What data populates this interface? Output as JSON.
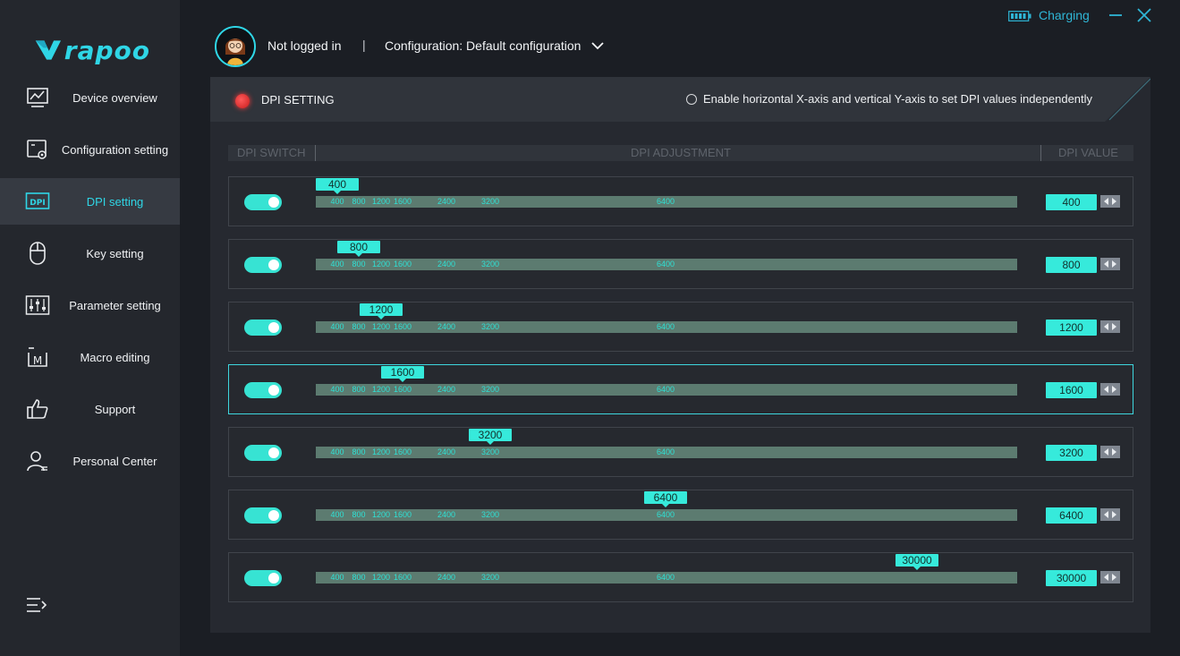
{
  "brand": {
    "name": "rapoo",
    "accent": "#2fd6e6"
  },
  "sidebar": {
    "items": [
      {
        "label": "Device overview",
        "icon": "chart-monitor-icon"
      },
      {
        "label": "Configuration setting",
        "icon": "config-gear-icon"
      },
      {
        "label": "DPI setting",
        "icon": "dpi-icon",
        "icon_text": "DPI",
        "active": true
      },
      {
        "label": "Key setting",
        "icon": "mouse-icon"
      },
      {
        "label": "Parameter setting",
        "icon": "sliders-icon"
      },
      {
        "label": "Macro editing",
        "icon": "macro-icon",
        "icon_text": "M"
      },
      {
        "label": "Support",
        "icon": "thumbs-up-icon"
      },
      {
        "label": "Personal Center",
        "icon": "user-icon"
      }
    ],
    "toggle_icon": "menu-expand-icon"
  },
  "topbar": {
    "user_status": "Not logged in",
    "separator": "|",
    "configuration": "Configuration: Default configuration",
    "charging": "Charging"
  },
  "panel": {
    "title": "DPI SETTING",
    "xy_option": "Enable horizontal X-axis and vertical Y-axis to set DPI values independently",
    "xy_enabled": false,
    "headers": {
      "switch": "DPI SWITCH",
      "adjust": "DPI ADJUSTMENT",
      "value": "DPI VALUE"
    }
  },
  "dpi": {
    "min": 400,
    "max": 30000,
    "tick_labels": [
      "400",
      "800",
      "1200",
      "1600",
      "2400",
      "3200",
      "6400"
    ],
    "levels": [
      {
        "value": 400,
        "label": "400",
        "enabled": true
      },
      {
        "value": 800,
        "label": "800",
        "enabled": true
      },
      {
        "value": 1200,
        "label": "1200",
        "enabled": true
      },
      {
        "value": 1600,
        "label": "1600",
        "enabled": true,
        "selected": true
      },
      {
        "value": 3200,
        "label": "3200",
        "enabled": true
      },
      {
        "value": 6400,
        "label": "6400",
        "enabled": true
      },
      {
        "value": 30000,
        "label": "30000",
        "enabled": true
      }
    ]
  }
}
